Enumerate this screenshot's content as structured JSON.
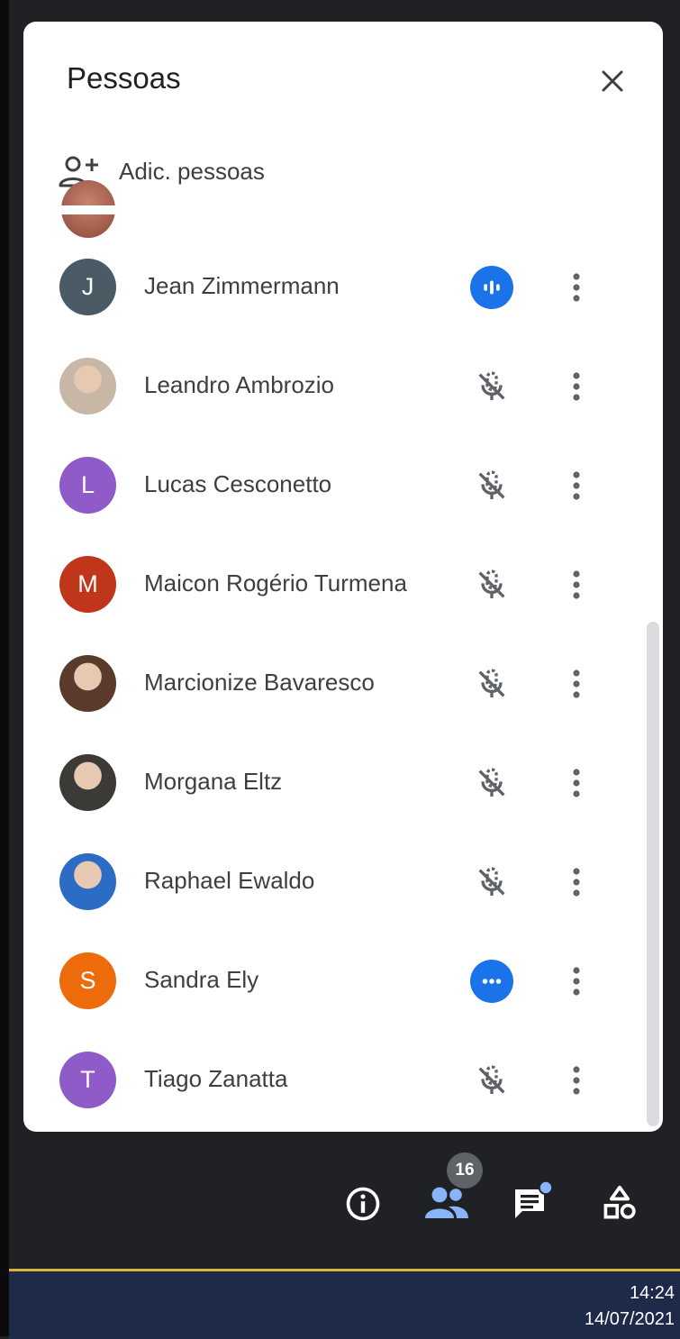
{
  "panel": {
    "title": "Pessoas",
    "add_people_label": "Adic. pessoas"
  },
  "people": [
    {
      "name": "Jean Zimmermann",
      "initial": "J",
      "avatar_color": "#4a5b66",
      "mic": "speaking"
    },
    {
      "name": "Leandro Ambrozio",
      "initial": "",
      "avatar_color": "#c8b7a6",
      "mic": "muted"
    },
    {
      "name": "Lucas Cesconetto",
      "initial": "L",
      "avatar_color": "#8e5bc8",
      "mic": "muted"
    },
    {
      "name": "Maicon Rogério Turmena",
      "initial": "M",
      "avatar_color": "#c0361b",
      "mic": "muted"
    },
    {
      "name": "Marcionize Bavaresco",
      "initial": "",
      "avatar_color": "#5a3a2a",
      "mic": "muted"
    },
    {
      "name": "Morgana Eltz",
      "initial": "",
      "avatar_color": "#3c3a36",
      "mic": "muted"
    },
    {
      "name": "Raphael Ewaldo",
      "initial": "",
      "avatar_color": "#2d6cc4",
      "mic": "muted"
    },
    {
      "name": "Sandra Ely",
      "initial": "S",
      "avatar_color": "#ee6b0b",
      "mic": "more"
    },
    {
      "name": "Tiago Zanatta",
      "initial": "T",
      "avatar_color": "#8e5bc8",
      "mic": "muted"
    }
  ],
  "toolbar": {
    "participant_count": "16"
  },
  "taskbar": {
    "time": "14:24",
    "date": "14/07/2021"
  },
  "colors": {
    "accent": "#1a73e8",
    "panel_bg": "#ffffff",
    "app_bg": "#202124",
    "people_icon": "#8ab4f8"
  }
}
